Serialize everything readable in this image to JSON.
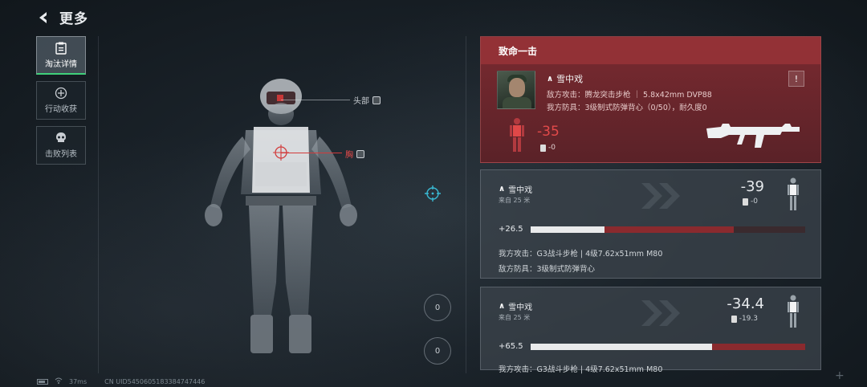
{
  "header": {
    "title": "更多"
  },
  "nav": [
    {
      "label": "淘汰详情",
      "icon": "clipboard-icon",
      "active": true
    },
    {
      "label": "行动收获",
      "icon": "medal-icon",
      "active": false
    },
    {
      "label": "击败列表",
      "icon": "skull-icon",
      "active": false
    }
  ],
  "model": {
    "head_label": "头部",
    "chest_label": "胸"
  },
  "fatal": {
    "header": "致命一击",
    "enemy_name": "雪中戏",
    "enemy_attack": "敌方攻击：腾龙突击步枪 ｜ 5.8x42mm DVP88",
    "enemy_armor": "我方防具：3级制式防弹背心（0/50），耐久度0",
    "damage": "-35",
    "armor_damage": "-0",
    "warn_symbol": "!"
  },
  "hits": [
    {
      "name": "雪中戏",
      "distance": "来自 25 米",
      "damage": "-39",
      "armor_damage": "-0",
      "heal": "+26.5",
      "bar_white": 0.27,
      "bar_red": 0.47,
      "attack_line": "我方攻击：G3战斗步枪 | 4级7.62x51mm M80",
      "armor_line": "敌方防具：3级制式防弹背心"
    },
    {
      "name": "雪中戏",
      "distance": "来自 25 米",
      "damage": "-34.4",
      "armor_damage": "-19.3",
      "heal": "+65.5",
      "bar_white": 0.66,
      "bar_red": 0.34,
      "attack_line": "我方攻击：G3战斗步枪 | 4级7.62x51mm M80",
      "armor_line": ""
    }
  ],
  "footer": {
    "ping": "37ms",
    "uid": "CN UID5450605183384747446"
  },
  "round_buttons": [
    "0",
    "0"
  ],
  "colors": {
    "accent_green": "#3fd07a",
    "fatal_red": "#7a2a30",
    "damage_red": "#e24a4a"
  }
}
